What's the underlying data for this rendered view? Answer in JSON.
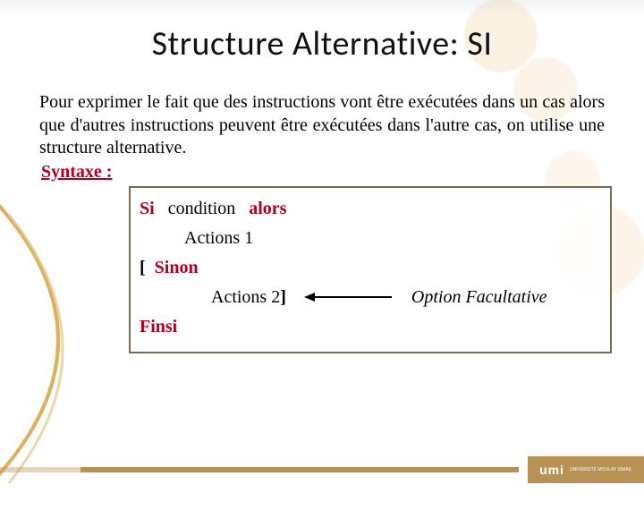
{
  "title": "Structure Alternative: SI",
  "intro": "Pour exprimer le fait que des instructions vont être exécutées dans un cas alors que d'autres instructions peuvent être exécutées dans l'autre cas, on utilise une structure alternative.",
  "syntax_label": "Syntaxe :",
  "code": {
    "si": "Si",
    "condition": "condition",
    "alors": "alors",
    "actions1": "Actions 1",
    "bracket_open": "[",
    "sinon": "Sinon",
    "actions2": "Actions 2",
    "bracket_close": "]",
    "finsi": "Finsi"
  },
  "option_label": "Option Facultative",
  "footer": {
    "logo_main": "umi",
    "logo_sub": "UNIVERSITÉ MOULAY ISMAIL"
  }
}
